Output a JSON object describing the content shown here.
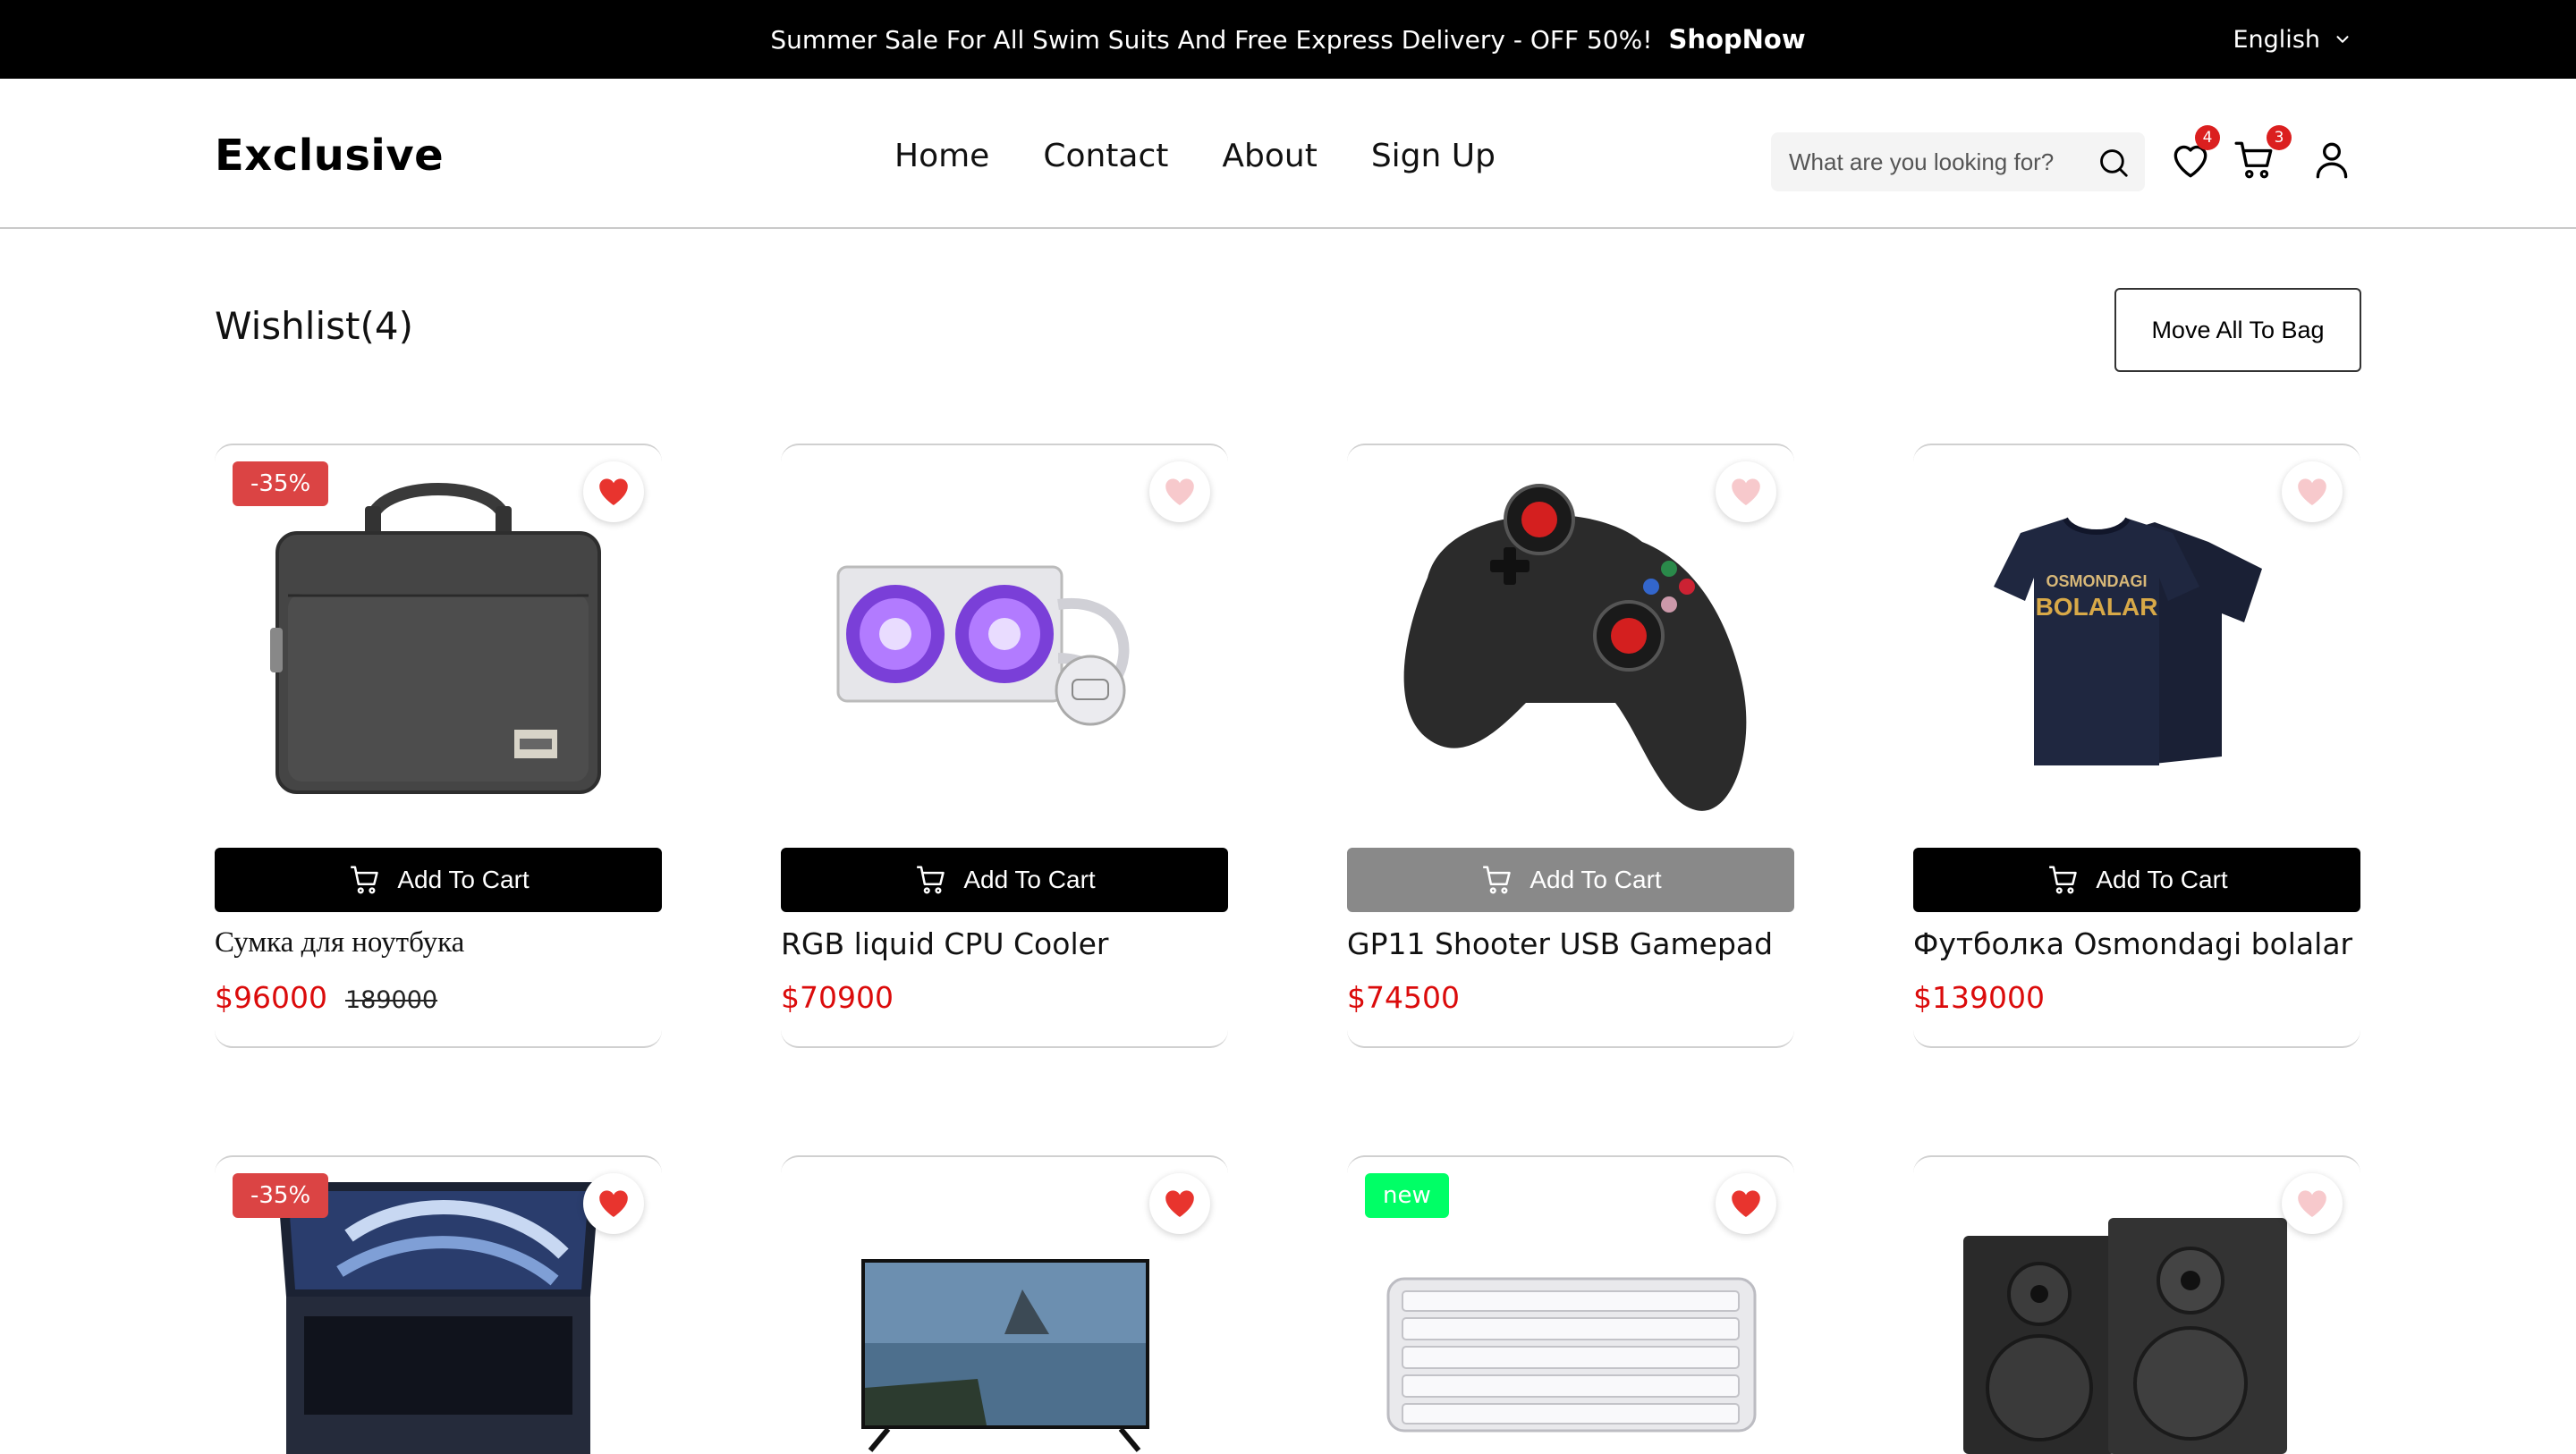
{
  "topbar": {
    "message": "Summer Sale For All Swim Suits And Free Express Delivery - OFF 50%!",
    "shop_now": "ShopNow",
    "language": "English"
  },
  "header": {
    "logo": "Exclusive",
    "nav": [
      "Home",
      "Contact",
      "About",
      "Sign Up"
    ],
    "search_placeholder": "What are you looking for?",
    "wishlist_count": "4",
    "cart_count": "3"
  },
  "wishlist": {
    "title": "Wishlist(4)",
    "move_all_label": "Move All To Bag",
    "add_to_cart_label": "Add To Cart"
  },
  "products": [
    {
      "name": "Сумка для ноутбука",
      "price": "$96000",
      "old_price": "189000",
      "tag": "-35%",
      "liked": true,
      "image": "laptop-bag-image"
    },
    {
      "name": "RGB liquid CPU Cooler",
      "price": "$70900",
      "old_price": "",
      "tag": "",
      "liked": false,
      "image": "cpu-cooler-image"
    },
    {
      "name": "GP11 Shooter USB Gamepad",
      "price": "$74500",
      "old_price": "",
      "tag": "",
      "liked": false,
      "image": "gamepad-image"
    },
    {
      "name": "Футболка Osmondagi bolalar",
      "price": "$139000",
      "old_price": "",
      "tag": "",
      "liked": false,
      "image": "tshirt-image",
      "tshirt_text_1": "OSMONDAGI",
      "tshirt_text_2": "BOLALAR"
    },
    {
      "tag": "-35%",
      "liked": true,
      "image": "laptop-image"
    },
    {
      "tag": "",
      "liked": true,
      "image": "tv-image"
    },
    {
      "tag": "new",
      "liked": true,
      "image": "keyboard-image"
    },
    {
      "tag": "",
      "liked": false,
      "image": "speakers-image"
    }
  ],
  "colors": {
    "accent_red": "#db4444",
    "price_red": "#db0b0b",
    "new_green": "#00ff66",
    "heart_liked": "#e8342e",
    "heart_unliked": "#f7c9cc"
  }
}
